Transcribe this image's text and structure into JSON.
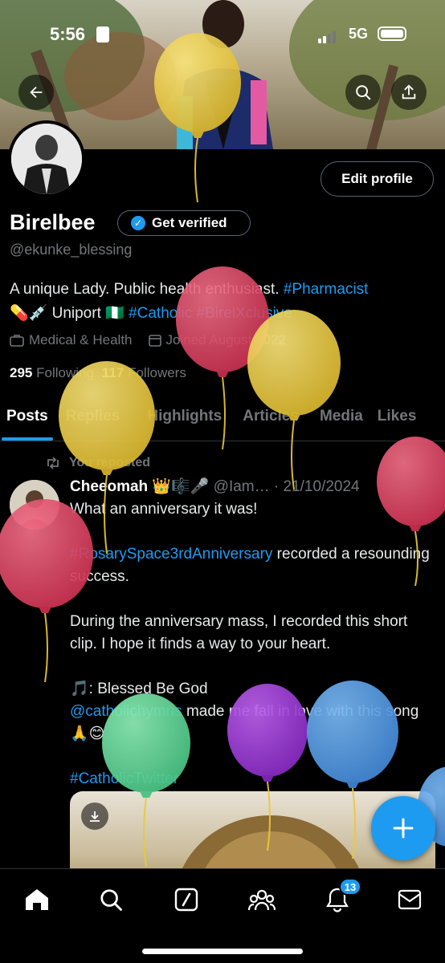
{
  "status_bar": {
    "time": "5:56",
    "network": "5G"
  },
  "profile": {
    "display_name": "Birelbee",
    "get_verified_label": "Get verified",
    "handle": "@ekunke_blessing",
    "edit_profile_label": "Edit profile",
    "bio_line1_text": "A unique Lady. Public health enthusiast.",
    "bio_line1_tag": "#Pharmacist",
    "bio_line2_emoji": "💊💉 Uniport 🇳🇬",
    "bio_line2_tags": "#Catholic #BirelXclusive",
    "category": "Medical & Health",
    "joined": "Joined August 2022",
    "following_count": "295",
    "following_label": "Following",
    "followers_count": "117",
    "followers_label": "Followers"
  },
  "tabs": [
    "Posts",
    "Replies",
    "Highlights",
    "Articles",
    "Media",
    "Likes"
  ],
  "post": {
    "repost_label": "You reposted",
    "author": "Cheeomah 👑🎼🎤",
    "handle_date": "@Iam… · 21/10/2024",
    "line1": "What an anniversary it was!",
    "hashtag1": "#RosarySpace3rdAnniversary",
    "line2_rest": " recorded a resounding success.",
    "line3": "During the anniversary mass, I recorded this short clip. I hope it finds a way to your heart.",
    "song_line": "🎵: Blessed Be God",
    "mention": "@catholichymns",
    "mention_rest": " made me fall in love with this song 🙏😊",
    "hashtag2": "#CatholicTwitter"
  },
  "bottom_nav": {
    "items": [
      "home-icon",
      "search-icon",
      "grok-icon",
      "communities-icon",
      "notifications-icon",
      "messages-icon"
    ],
    "notification_count": "13"
  },
  "colors": {
    "accent": "#1d9bf0",
    "background": "#000000",
    "muted_text": "#71767b",
    "balloon_yellow": "#e8c93a",
    "balloon_red": "#e0405e",
    "balloon_green": "#5fd49a",
    "balloon_purple": "#9b35d6",
    "balloon_blue": "#4f9de8"
  }
}
